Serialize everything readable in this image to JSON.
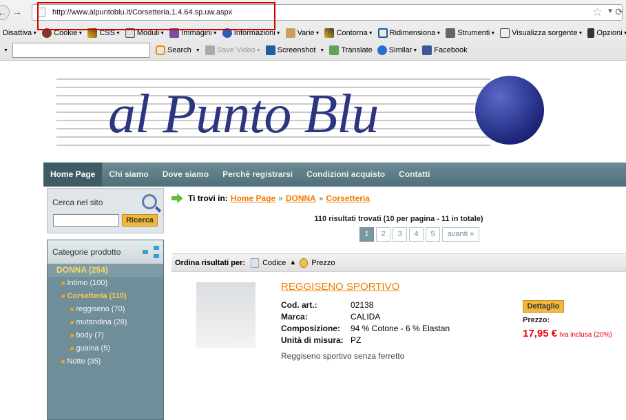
{
  "browser": {
    "url": "http://www.alpuntoblu.it/Corsetteria.1.4.64.sp.uw.aspx",
    "toolbar1": [
      "Disattiva",
      "Cookie",
      "CSS",
      "Moduli",
      "Immagini",
      "Informazioni",
      "Varie",
      "Contorna",
      "Ridimensiona",
      "Strumenti",
      "Visualizza sorgente",
      "Opzioni"
    ],
    "toolbar2": {
      "search_label": "Search",
      "save_video": "Save Video",
      "screenshot": "Screenshot",
      "translate": "Translate",
      "similar": "Similar",
      "facebook": "Facebook"
    }
  },
  "site": {
    "logo_text": "al Punto Blu",
    "menu": [
      "Home Page",
      "Chi siamo",
      "Dove siamo",
      "Perchè registrarsi",
      "Condizioni acquisto",
      "Contatti"
    ]
  },
  "sidebar": {
    "search_title": "Cerca nel sito",
    "search_button": "Ricerca",
    "categories_title": "Categorie prodotto",
    "categories": [
      {
        "label": "DONNA (254)",
        "level": 0
      },
      {
        "label": "Intimo (100)",
        "level": 1
      },
      {
        "label": "Corsetteria (110)",
        "level": 1,
        "selected": true
      },
      {
        "label": "reggiseno (70)",
        "level": 2
      },
      {
        "label": "mutandina (28)",
        "level": 2
      },
      {
        "label": "body (7)",
        "level": 2
      },
      {
        "label": "guaina (5)",
        "level": 2
      },
      {
        "label": "Notte (35)",
        "level": 1
      }
    ]
  },
  "content": {
    "breadcrumb_label": "Ti trovi in:",
    "breadcrumb": [
      "Home Page",
      "DONNA",
      "Corsetteria"
    ],
    "results_text": "110 risultati trovati (10 per pagina - 11 in totale)",
    "pages": [
      "1",
      "2",
      "3",
      "4",
      "5"
    ],
    "next_label": "avanti »",
    "sort_label": "Ordina risultati per:",
    "sort_options": [
      "Codice",
      "Prezzo"
    ],
    "product": {
      "title": "REGGISENO SPORTIVO",
      "specs": [
        {
          "k": "Cod. art.:",
          "v": "02138"
        },
        {
          "k": "Marca:",
          "v": "CALIDA"
        },
        {
          "k": "Composizione:",
          "v": "94 % Cotone - 6 % Elastan"
        },
        {
          "k": "Unità di misura:",
          "v": "PZ"
        }
      ],
      "description": "Reggiseno sportivo senza ferretto",
      "detail_button": "Dettaglio",
      "price_label": "Prezzo:",
      "price": "17,95 €",
      "price_note": "Iva inclusa (20%)"
    }
  }
}
